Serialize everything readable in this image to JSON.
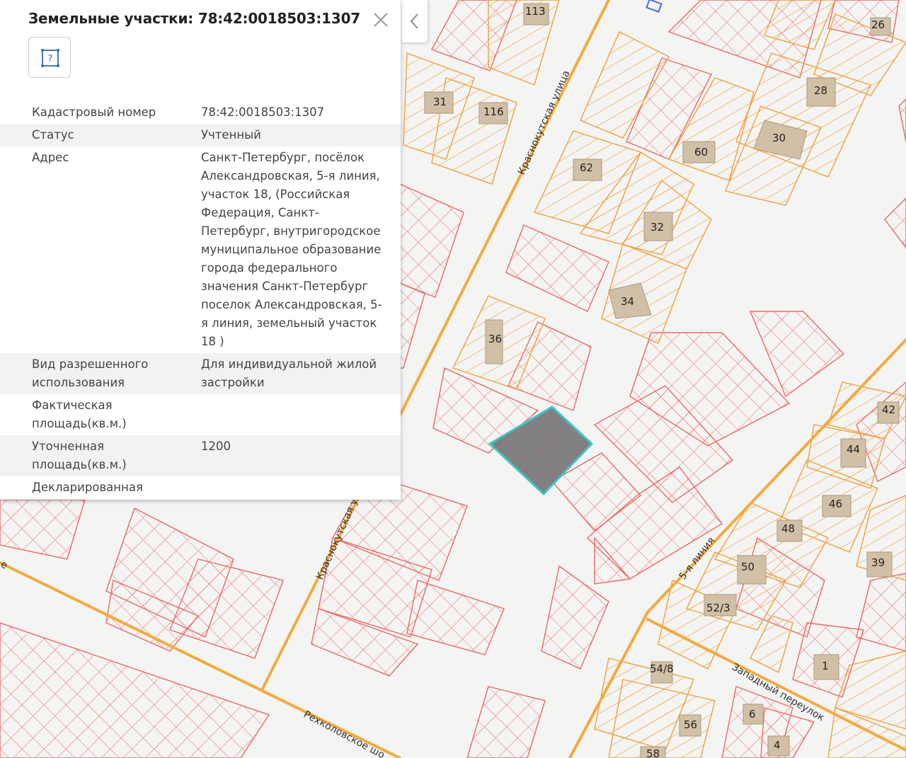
{
  "panel": {
    "title": "Земельные участки: 78:42:0018503:1307",
    "type_icon": "parcel-square-icon",
    "close_icon": "close-icon",
    "collapse_icon": "chevron-left-icon",
    "properties": [
      {
        "label": "Кадастровый номер",
        "value": "78:42:0018503:1307"
      },
      {
        "label": "Статус",
        "value": "Учтенный"
      },
      {
        "label": "Адрес",
        "value": "Санкт-Петербург, посёлок Александровская, 5-я линия, участок 18, (Российская Федерация, Санкт-Петербург, внутригородское муниципальное образование города федерального значения Санкт-Петербург поселок Александровская, 5-я линия, земельный участок 18 )"
      },
      {
        "label": "Вид разрешенного использования",
        "value": "Для индивидуальной жилой застройки"
      },
      {
        "label": "Фактическая площадь(кв.м.)",
        "value": ""
      },
      {
        "label": "Уточненная площадь(кв.м.)",
        "value": "1200"
      },
      {
        "label": "Декларированная",
        "value": ""
      }
    ]
  },
  "map": {
    "roads": [
      "Краснокутская улица",
      "Краснокутская ул",
      "5-я линия",
      "Западный переулок",
      "Рехколовское шо",
      "е"
    ],
    "house_numbers": [
      "113",
      "26",
      "31",
      "116",
      "28",
      "30",
      "60",
      "62",
      "32",
      "34",
      "36",
      "42",
      "44",
      "46",
      "48",
      "50",
      "39",
      "52/3",
      "1",
      "54/8",
      "56",
      "6",
      "4",
      "58"
    ],
    "colors": {
      "background": "#f4f4f2",
      "road": "#f2aa40",
      "parcel_red": "#e86a6a",
      "parcel_orange": "#f0a040",
      "building": "#d2c0a6",
      "selected_fill": "#7a7a7e",
      "selected_stroke": "#34c5c5"
    }
  }
}
